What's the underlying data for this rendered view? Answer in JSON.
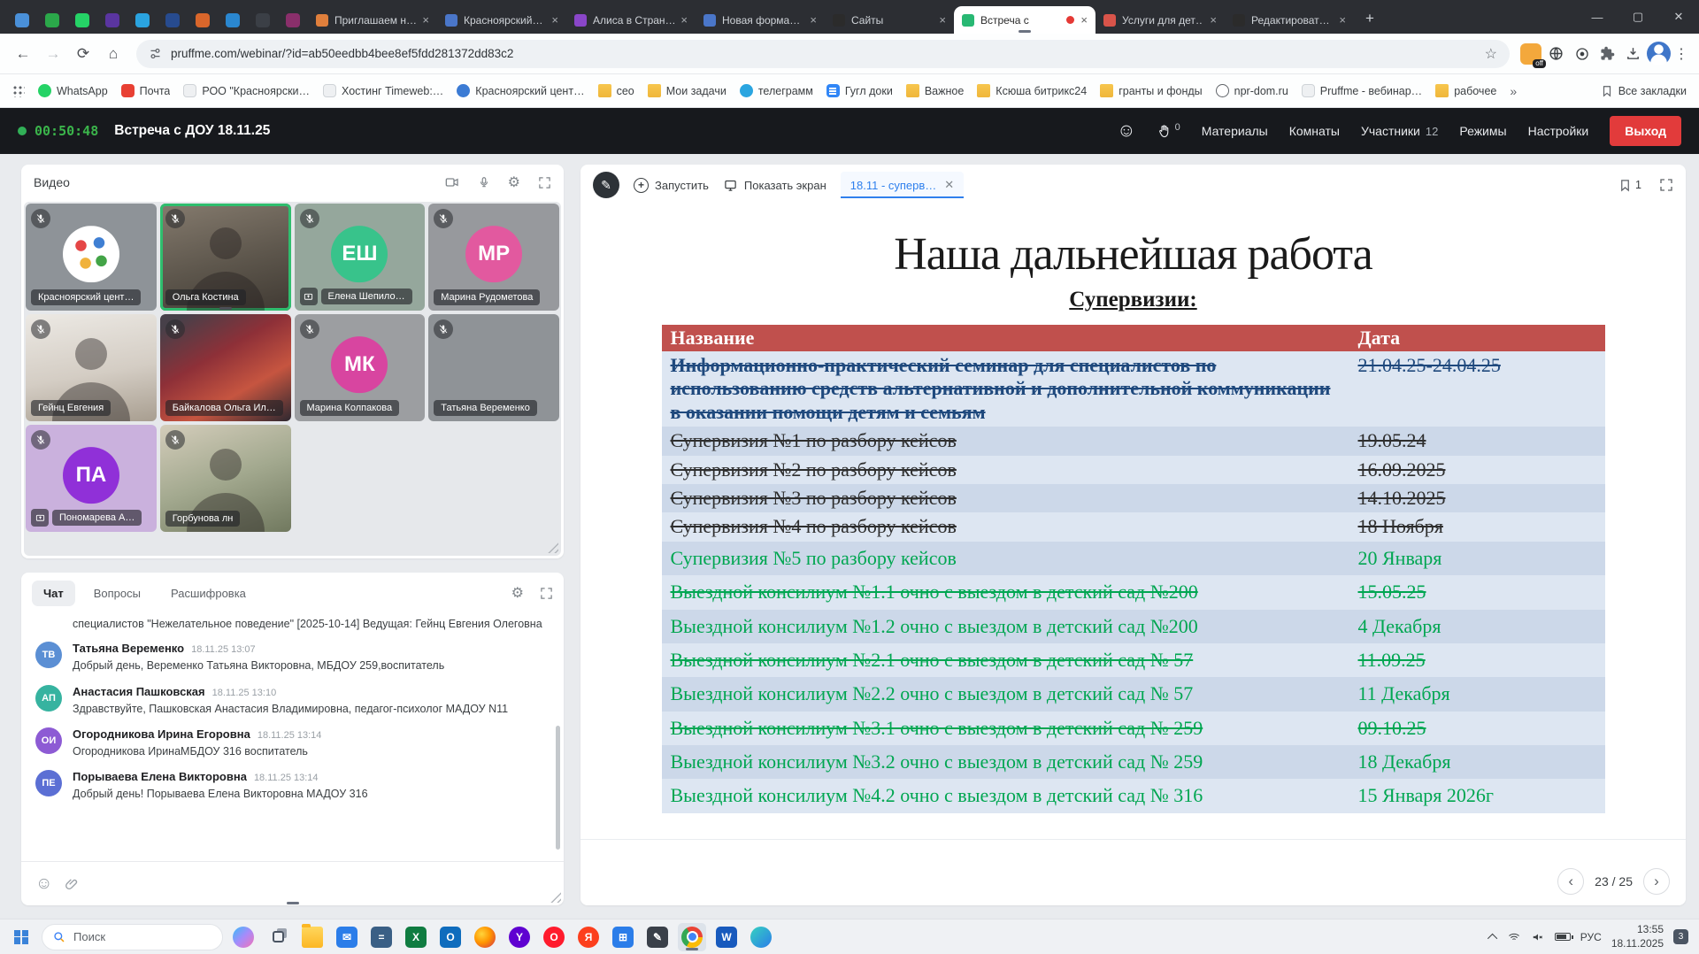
{
  "browser": {
    "pinned_tabs": [
      {
        "name": "pinned-tab-1",
        "color": "#4a90d9"
      },
      {
        "name": "pinned-tab-2",
        "color": "#2ba84a"
      },
      {
        "name": "pinned-tab-3",
        "color": "#25d366"
      },
      {
        "name": "pinned-tab-4",
        "color": "#5a35a0"
      },
      {
        "name": "pinned-tab-5",
        "color": "#2aa3e0"
      },
      {
        "name": "pinned-tab-6",
        "color": "#274b8f"
      },
      {
        "name": "pinned-tab-7",
        "color": "#d9662b"
      },
      {
        "name": "pinned-tab-8",
        "color": "#2a87d0"
      },
      {
        "name": "pinned-tab-9",
        "color": "#3b3f46"
      },
      {
        "name": "pinned-tab-10",
        "color": "#8a2f6b"
      }
    ],
    "tabs": [
      {
        "title": "Приглашаем н…",
        "icon_color": "#e07f3c"
      },
      {
        "title": "Красноярский…",
        "icon_color": "#4a76c9"
      },
      {
        "title": "Алиса в Стран…",
        "icon_color": "#8a46c9"
      },
      {
        "title": "Новая форма…",
        "icon_color": "#4a76c9"
      },
      {
        "title": "Сайты",
        "icon_color": "#2b2b2b"
      },
      {
        "title": "Встреча с",
        "icon_color": "#28b873",
        "cls": "active rec"
      },
      {
        "title": "Услуги для дет…",
        "icon_color": "#d9544a"
      },
      {
        "title": "Редактироват…",
        "icon_color": "#2b2b2b"
      }
    ],
    "url": "pruffme.com/webinar/?id=ab50eedbb4bee8ef5fdd281372dd83c2",
    "ext_off_badge": "off",
    "bookmarks": [
      {
        "label": "WhatsApp",
        "cls": "whatsapp"
      },
      {
        "label": "Почта",
        "cls": "mail"
      },
      {
        "label": "РОО \"Красноярски…",
        "cls": "page"
      },
      {
        "label": "Хостинг Timeweb:…",
        "cls": "page"
      },
      {
        "label": "Красноярский цент…",
        "cls": "siteblue"
      },
      {
        "label": "сео",
        "cls": "folder"
      },
      {
        "label": "Мои задачи",
        "cls": "folder"
      },
      {
        "label": "телеграмм",
        "cls": "telegram"
      },
      {
        "label": "Гугл доки",
        "cls": "gdoc"
      },
      {
        "label": "Важное",
        "cls": "folder"
      },
      {
        "label": "Ксюша битрикс24",
        "cls": "folder"
      },
      {
        "label": "гранты и фонды",
        "cls": "folder"
      },
      {
        "label": "npr-dom.ru",
        "cls": "globe"
      },
      {
        "label": "Pruffme - вебинар…",
        "cls": "page"
      },
      {
        "label": "рабочее",
        "cls": "folder"
      }
    ],
    "all_bookmarks_label": "Все закладки"
  },
  "webinar": {
    "timer": "00:50:48",
    "title": "Встреча с ДОУ 18.11.25",
    "hand_count": "0",
    "nav": [
      {
        "label": "Материалы"
      },
      {
        "label": "Комнаты"
      },
      {
        "label": "Участники",
        "badge": "12"
      },
      {
        "label": "Режимы"
      },
      {
        "label": "Настройки"
      }
    ],
    "exit_label": "Выход"
  },
  "video": {
    "title": "Видео",
    "tiles": [
      {
        "name": "Красноярский цент…",
        "cls": "logo",
        "bg": "#8e9398"
      },
      {
        "name": "Ольга Костина",
        "cls": "video active",
        "bg": "linear-gradient(165deg,#857b6e,#5d564c 55%,#403a33)"
      },
      {
        "name": "Елена Шепило…",
        "cls": "initials share",
        "initials": "ЕШ",
        "bg": "#95a79c",
        "circle": "#38c38b"
      },
      {
        "name": "Марина Рудометова",
        "cls": "initials",
        "initials": "МР",
        "bg": "#97999d",
        "circle": "#e2599f"
      },
      {
        "name": "Гейнц Евгения",
        "cls": "video",
        "bg": "linear-gradient(170deg,#ece9e4,#d4cdc4 55%,#a89e90)"
      },
      {
        "name": "Байкалова Ольга Ил…",
        "cls": "video nosil",
        "bg": "linear-gradient(150deg,#474049 8%,#8e3038 40%,#c65540 68%,#2e2830)"
      },
      {
        "name": "Марина Колпакова",
        "cls": "initials",
        "initials": "МК",
        "bg": "#9c9ea1",
        "circle": "#d845a0"
      },
      {
        "name": "Татьяна Веременко",
        "cls": "empty",
        "bg": "#8f9397"
      },
      {
        "name": "Пономарева А…",
        "cls": "initials share",
        "initials": "ПА",
        "bg": "#cab1dd",
        "circle": "#9030d8"
      },
      {
        "name": "Горбунова лн",
        "cls": "video",
        "bg": "linear-gradient(160deg,#d4cdbb,#a3a98f 50%,#71795f)"
      }
    ]
  },
  "chat": {
    "tabs": [
      {
        "label": "Чат",
        "cls": "active"
      },
      {
        "label": "Вопросы"
      },
      {
        "label": "Расшифровка"
      }
    ],
    "partial": "специалистов \"Нежелательное поведение\" [2025-10-14] Ведущая: Гейнц Евгения Олеговна",
    "messages": [
      {
        "initials": "ТВ",
        "color": "#5b8fd4",
        "name": "Татьяна Веременко",
        "time": "18.11.25 13:07",
        "text": "Добрый день, Веременко Татьяна Викторовна, МБДОУ 259,воспитатель"
      },
      {
        "initials": "АП",
        "color": "#36b3a0",
        "name": "Анастасия Пашковская",
        "time": "18.11.25 13:10",
        "text": "Здравствуйте, Пашковская Анастасия Владимировна, педагог-психолог МАДОУ N11"
      },
      {
        "initials": "ОИ",
        "color": "#8d5bd4",
        "name": "Огородникова Ирина Егоровна",
        "time": "18.11.25 13:14",
        "text": "Огородникова ИринаМБДОУ 316 воспитатель"
      },
      {
        "initials": "ПЕ",
        "color": "#5b6fd4",
        "name": "Порываева Елена Викторовна",
        "time": "18.11.25 13:14",
        "text": "Добрый день! Порываева Елена Викторовна МАДОУ 316"
      }
    ]
  },
  "presentation": {
    "toolbar": {
      "launch_label": "Запустить",
      "screen_label": "Показать экран",
      "doc_tab": "18.11 - суперв…",
      "bookmark_count": "1"
    },
    "slide": {
      "title": "Наша дальнейшая работа",
      "subtitle": "Супервизии:",
      "table": {
        "headers": {
          "name": "Название",
          "date": "Дата"
        },
        "rows": [
          {
            "name": "Информационно-практический семинар для специалистов по использованию средств альтернативной и дополнительной коммуникации в оказании помощи детям и семьям",
            "date": "21.04.25-24.04.25",
            "color": "#1F497D",
            "cls": "struck bold"
          },
          {
            "name": "Супервизия №1  по разбору кейсов",
            "date": "19.05.24",
            "color": "#2e2e2e",
            "cls": "struck"
          },
          {
            "name": "Супервизия №2 по разбору кейсов",
            "date": "16.09.2025",
            "color": "#2e2e2e",
            "cls": "struck"
          },
          {
            "name": "Супервизия №3 по разбору кейсов",
            "date": "14.10.2025",
            "color": "#2e2e2e",
            "cls": "struck"
          },
          {
            "name": "Супервизия №4 по разбору кейсов",
            "date": "18 Ноября",
            "color": "#2e2e2e",
            "cls": "struck"
          },
          {
            "name": "Супервизия №5 по разбору кейсов",
            "date": "20 Января",
            "color": "#00A651"
          },
          {
            "name": "Выездной консилиум №1.1 очно с выездом в детский сад №200",
            "date": "15.05.25",
            "color": "#00A651",
            "cls": "struck"
          },
          {
            "name": "Выездной консилиум №1.2 очно с выездом в детский сад №200",
            "date": "4 Декабря",
            "color": "#00A651"
          },
          {
            "name": "Выездной консилиум №2.1 очно с выездом в детский сад № 57",
            "date": "11.09.25",
            "color": "#00A651",
            "cls": "struck"
          },
          {
            "name": "Выездной консилиум №2.2 очно с выездом в детский сад № 57",
            "date": "11 Декабря",
            "color": "#00A651"
          },
          {
            "name": "Выездной консилиум №3.1 очно с выездом в детский сад № 259",
            "date": "09.10.25",
            "color": "#00A651",
            "cls": "struck"
          },
          {
            "name": "Выездной консилиум №3.2 очно с выездом в детский сад № 259",
            "date": "18 Декабря",
            "color": "#00A651"
          },
          {
            "name": "Выездной консилиум №4.2 очно с выездом в детский сад № 316",
            "date": "15 Января 2026г",
            "color": "#00A651"
          }
        ]
      }
    },
    "pagination": "23 / 25"
  },
  "taskbar": {
    "search_label": "Поиск",
    "apps": [
      {
        "name": "copilot",
        "cls": "copilot round"
      },
      {
        "name": "task-view",
        "cls": "taskview"
      },
      {
        "name": "explorer",
        "cls": "explorer"
      },
      {
        "name": "mail",
        "glyph": "✉",
        "bg": "#2b7de9"
      },
      {
        "name": "calculator",
        "glyph": "=",
        "bg": "#3a5f85"
      },
      {
        "name": "excel",
        "glyph": "X",
        "bg": "#107c41"
      },
      {
        "name": "outlook",
        "glyph": "O",
        "bg": "#0f6cbd"
      },
      {
        "name": "firefox",
        "cls": "firefox round"
      },
      {
        "name": "yahoo",
        "glyph": "Y",
        "bg": "#5f01d1",
        "cls": "round"
      },
      {
        "name": "opera",
        "glyph": "O",
        "bg": "#ff1b2d",
        "cls": "round"
      },
      {
        "name": "yandex-browser",
        "glyph": "Я",
        "bg": "#fc3f1d",
        "cls": "round"
      },
      {
        "name": "table-app",
        "glyph": "⊞",
        "bg": "#2b7de9"
      },
      {
        "name": "notes",
        "glyph": "✎",
        "bg": "#3a4049"
      },
      {
        "name": "chrome",
        "cls": "chrome round active"
      },
      {
        "name": "word",
        "glyph": "W",
        "bg": "#185abd"
      },
      {
        "name": "edge",
        "cls": "edge round"
      }
    ],
    "lang": "РУС",
    "time": "13:55",
    "date": "18.11.2025",
    "badge": "3"
  }
}
